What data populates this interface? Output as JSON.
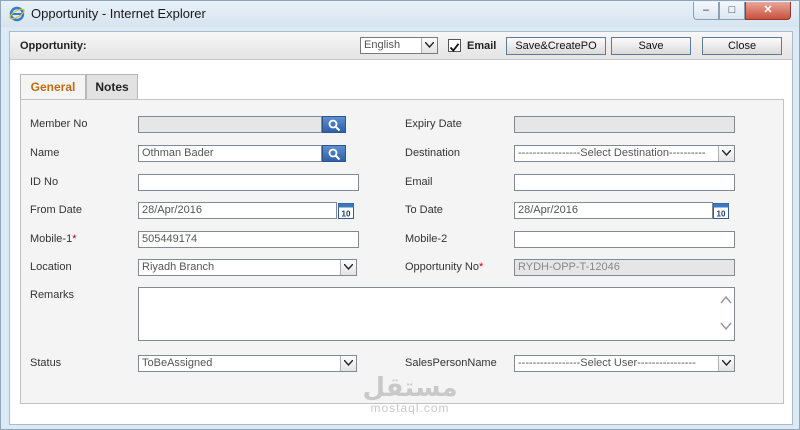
{
  "window": {
    "title": "Opportunity - Internet Explorer",
    "min_icon": "minimize-icon",
    "max_icon": "maximize-icon",
    "close_icon": "close-icon"
  },
  "toolbar": {
    "title": "Opportunity:",
    "language": "English",
    "email_checked": true,
    "email_label": "Email",
    "save_create_po": "Save&CreatePO",
    "save": "Save",
    "close": "Close"
  },
  "tabs": [
    {
      "label": "General",
      "active": true
    },
    {
      "label": "Notes",
      "active": false
    }
  ],
  "form": {
    "member_no": {
      "label": "Member No",
      "value": ""
    },
    "expiry_date": {
      "label": "Expiry Date",
      "value": ""
    },
    "name": {
      "label": "Name",
      "value": "Othman   Bader"
    },
    "destination": {
      "label": "Destination",
      "value": "-----------------Select Destination----------"
    },
    "id_no": {
      "label": "ID No",
      "value": ""
    },
    "email": {
      "label": "Email",
      "value": ""
    },
    "from_date": {
      "label": "From Date",
      "value": "28/Apr/2016"
    },
    "to_date": {
      "label": "To Date",
      "value": "28/Apr/2016"
    },
    "mobile1": {
      "label": "Mobile-1",
      "value": "505449174"
    },
    "mobile2": {
      "label": "Mobile-2",
      "value": ""
    },
    "location": {
      "label": "Location",
      "value": "Riyadh Branch"
    },
    "opportunity_no": {
      "label": "Opportunity No",
      "value": "RYDH-OPP-T-12046"
    },
    "remarks": {
      "label": "Remarks",
      "value": ""
    },
    "status": {
      "label": "Status",
      "value": "ToBeAssigned"
    },
    "sales_person": {
      "label": "SalesPersonName",
      "value": "-----------------Select User----------------"
    },
    "calendar_day": "10",
    "required_mark": "*"
  },
  "watermark": {
    "arabic": "مستقل",
    "latin": "mostaql.com"
  },
  "colors": {
    "active_tab": "#c06a12",
    "search_button": "#2e5fa8",
    "required": "#cc0000"
  }
}
